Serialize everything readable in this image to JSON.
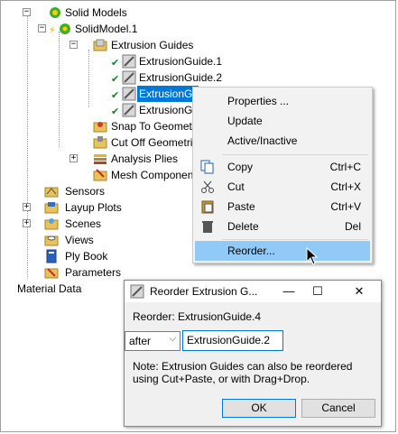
{
  "tree": {
    "solid_models": "Solid Models",
    "solid_model_1": "SolidModel.1",
    "extrusion_guides": "Extrusion Guides",
    "guide_1": "ExtrusionGuide.1",
    "guide_2": "ExtrusionGuide.2",
    "guide_3": "ExtrusionGui",
    "guide_4": "ExtrusionGuide",
    "snap": "Snap To Geometri",
    "cutoff": "Cut Off Geometri",
    "analysis": "Analysis Plies",
    "mesh": "Mesh Componen",
    "sensors": "Sensors",
    "layup": "Layup Plots",
    "scenes": "Scenes",
    "views": "Views",
    "plybook": "Ply Book",
    "parameters": "Parameters",
    "material": "Material Data"
  },
  "menu": {
    "properties": "Properties ...",
    "update": "Update",
    "active": "Active/Inactive",
    "copy": "Copy",
    "copy_sc": "Ctrl+C",
    "cut": "Cut",
    "cut_sc": "Ctrl+X",
    "paste": "Paste",
    "paste_sc": "Ctrl+V",
    "delete": "Delete",
    "delete_sc": "Del",
    "reorder": "Reorder..."
  },
  "dialog": {
    "title": "Reorder Extrusion G...",
    "reorder_label": "Reorder:",
    "reorder_value": "ExtrusionGuide.4",
    "position": "after",
    "target": "ExtrusionGuide.2",
    "note": "Note: Extrusion Guides can also be reordered using Cut+Paste, or with Drag+Drop.",
    "ok": "OK",
    "cancel": "Cancel",
    "minimize": "—",
    "maximize": "☐",
    "close": "✕"
  }
}
